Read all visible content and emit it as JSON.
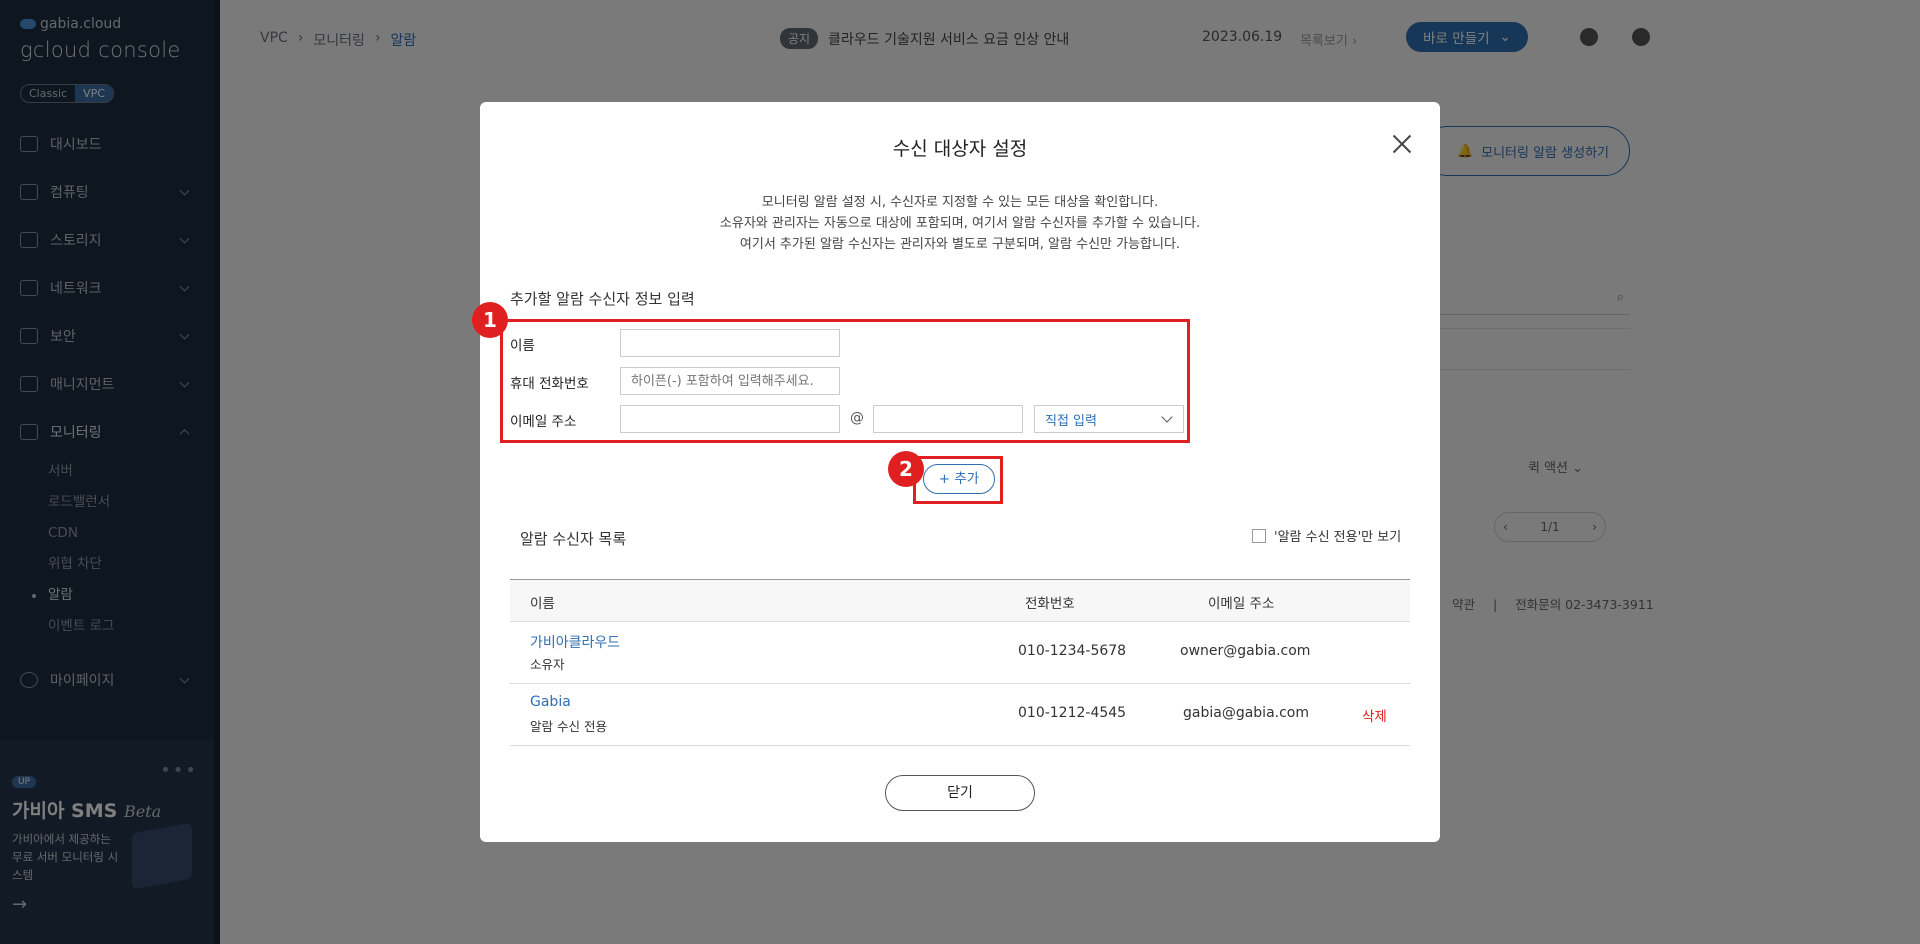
{
  "sidebar": {
    "brand_small": "gabia.cloud",
    "brand_big": "gcloud console",
    "toggle": [
      "Classic",
      "VPC"
    ],
    "items": [
      {
        "label": "대시보드"
      },
      {
        "label": "컴퓨팅"
      },
      {
        "label": "스토리지"
      },
      {
        "label": "네트워크"
      },
      {
        "label": "보안"
      },
      {
        "label": "매니지먼트"
      },
      {
        "label": "모니터링"
      },
      {
        "label": "마이페이지"
      }
    ],
    "monitoring_sub": [
      "서버",
      "로드밸런서",
      "CDN",
      "위협 차단",
      "알람",
      "이벤트 로그"
    ],
    "promo": {
      "badge": "UP",
      "title": "가비아 SMS",
      "title_script": "Beta",
      "desc": "가비아에서 제공하는 무료 서버 모니터링 시스템",
      "arrow": "→"
    }
  },
  "topbar": {
    "breadcrumb": [
      "VPC",
      "모니터링",
      "알람"
    ],
    "notice_tag": "공지",
    "notice_text": "클라우드 기술지원 서비스 요금 인상 안내",
    "notice_date": "2023.06.19",
    "notice_more": "목록보기",
    "make_button": "바로 만들기"
  },
  "background": {
    "create_alarm": "모니터링 알람 생성하기",
    "quick_action": "퀵 액션",
    "pager": "1/1",
    "footer_terms": "약관",
    "footer_phone": "전화문의 02-3473-3911"
  },
  "modal": {
    "title": "수신 대상자 설정",
    "description": [
      "모니터링 알람 설정 시, 수신자로 지정할 수 있는 모든 대상을 확인합니다.",
      "소유자와 관리자는 자동으로 대상에 포함되며, 여기서 알람 수신자를 추가할 수 있습니다.",
      "여기서 추가된 알람 수신자는 관리자와 별도로 구분되며, 알람 수신만 가능합니다."
    ],
    "form_title": "추가할 알람 수신자 정보 입력",
    "name_label": "이름",
    "name_value": "",
    "phone_label": "휴대 전화번호",
    "phone_placeholder": "하이픈(-) 포함하여 입력해주세요.",
    "email_label": "이메일 주소",
    "email_local": "",
    "email_at": "@",
    "email_domain": "",
    "email_select": "직접 입력",
    "add_button": "+ 추가",
    "marker_1": "1",
    "marker_2": "2",
    "list_title": "알람 수신자 목록",
    "filter_label": "'알람 수신 전용'만 보기",
    "table": {
      "headers": [
        "이름",
        "전화번호",
        "이메일 주소"
      ],
      "rows": [
        {
          "name": "가비아클라우드",
          "role": "소유자",
          "phone": "010-1234-5678",
          "email": "owner@gabia.com",
          "action": ""
        },
        {
          "name": "Gabia",
          "role": "알람 수신 전용",
          "phone": "010-1212-4545",
          "email": "gabia@gabia.com",
          "action": "삭제"
        }
      ]
    },
    "close_button": "닫기"
  }
}
